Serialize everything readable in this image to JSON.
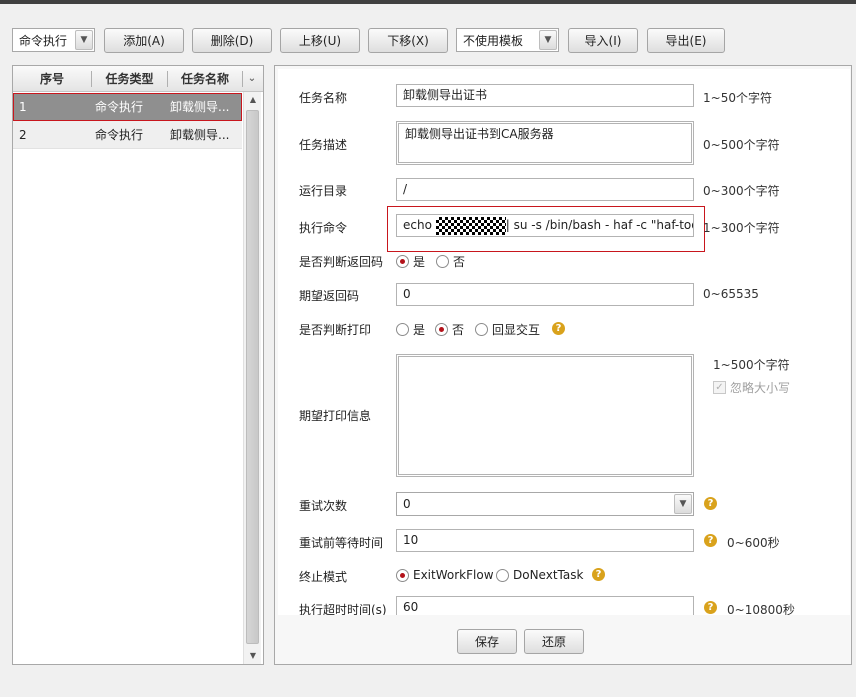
{
  "toolbar": {
    "task_type_value": "命令执行",
    "add_label": "添加(A)",
    "delete_label": "删除(D)",
    "moveup_label": "上移(U)",
    "movedown_label": "下移(X)",
    "template_value": "不使用模板",
    "import_label": "导入(I)",
    "export_label": "导出(E)"
  },
  "task_list": {
    "headers": [
      "序号",
      "任务类型",
      "任务名称"
    ],
    "rows": [
      {
        "index": "1",
        "type": "命令执行",
        "name": "卸载侧导..."
      },
      {
        "index": "2",
        "type": "命令执行",
        "name": "卸载侧导..."
      }
    ]
  },
  "form": {
    "task_name": {
      "label": "任务名称",
      "value": "卸载侧导出证书",
      "hint": "1~50个字符"
    },
    "task_desc": {
      "label": "任务描述",
      "value": "卸载侧导出证书到CA服务器",
      "hint": "0~500个字符"
    },
    "run_dir": {
      "label": "运行目录",
      "value": "/",
      "hint": "0~300个字符"
    },
    "command": {
      "label": "执行命令",
      "prefix": "echo ",
      "suffix": "| su -s /bin/bash - haf -c \"haf-tool ce",
      "hint": "1~300个字符"
    },
    "check_return": {
      "label": "是否判断返回码",
      "yes": "是",
      "no": "否",
      "selected": "yes"
    },
    "expected_return": {
      "label": "期望返回码",
      "value": "0",
      "hint": "0~65535"
    },
    "check_print": {
      "label": "是否判断打印",
      "yes": "是",
      "no": "否",
      "echo": "回显交互",
      "selected": "no"
    },
    "expected_print": {
      "label": "期望打印信息",
      "value": "",
      "hint": "1~500个字符",
      "ignore_case": "忽略大小写"
    },
    "retry_count": {
      "label": "重试次数",
      "value": "0"
    },
    "retry_wait": {
      "label": "重试前等待时间",
      "value": "10",
      "hint": "0~600秒"
    },
    "stop_mode": {
      "label": "终止模式",
      "opt1": "ExitWorkFlow",
      "opt2": "DoNextTask",
      "selected": "ExitWorkFlow"
    },
    "timeout": {
      "label": "执行超时时间(s)",
      "value": "60",
      "hint": "0~10800秒"
    }
  },
  "actions": {
    "save_label": "保存",
    "reset_label": "还原"
  },
  "icons": {
    "help": "help-icon",
    "dropdown": "chevron-down-icon"
  },
  "colors": {
    "selection_outline": "#c8161d",
    "radio_selected": "#b3121a",
    "help_icon": "#d9a21c",
    "selected_row": "#8f8f8f"
  }
}
